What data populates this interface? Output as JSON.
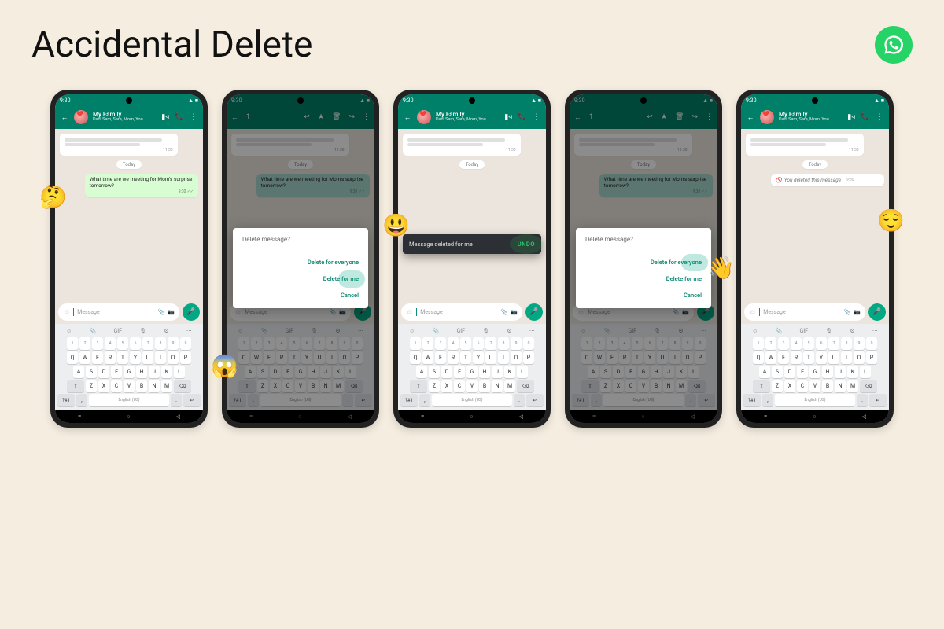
{
  "header": {
    "title": "Accidental Delete"
  },
  "common": {
    "time": "9:30",
    "chat_name": "My Family",
    "members": "Dad, Sam, Sara, Mom, You",
    "date_label": "Today",
    "received_time": "11:30",
    "sent_time": "9:30",
    "placeholder": "Message",
    "space_label": "English (US)",
    "mode_key": "?#1"
  },
  "message": {
    "text": "What time are we meeting for Mom's surprise tomorrow?"
  },
  "deleted": {
    "text": "You deleted this message"
  },
  "dialog": {
    "title": "Delete message?",
    "opt1": "Delete for everyone",
    "opt2": "Delete for me",
    "opt3": "Cancel"
  },
  "toast": {
    "text": "Message deleted for me",
    "action": "UNDO"
  },
  "sel": {
    "count": "1"
  },
  "emojis": {
    "think": "🤔",
    "scream": "😱",
    "grin": "😃",
    "wave": "👋",
    "relieved": "😌"
  },
  "kb": {
    "nums": [
      "1",
      "2",
      "3",
      "4",
      "5",
      "6",
      "7",
      "8",
      "9",
      "0"
    ],
    "r1": [
      "Q",
      "W",
      "E",
      "R",
      "T",
      "Y",
      "U",
      "I",
      "O",
      "P"
    ],
    "r2": [
      "A",
      "S",
      "D",
      "F",
      "G",
      "H",
      "J",
      "K",
      "L"
    ],
    "r3": [
      "Z",
      "X",
      "C",
      "V",
      "B",
      "N",
      "M"
    ]
  }
}
